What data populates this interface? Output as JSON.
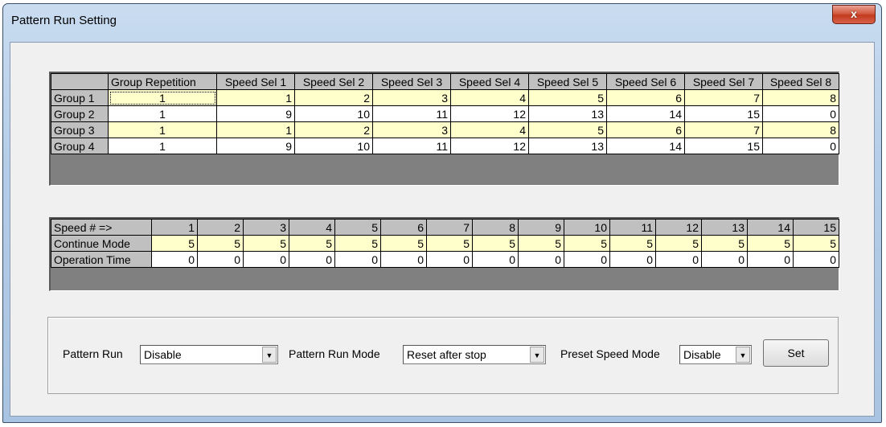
{
  "window": {
    "title": "Pattern Run Setting",
    "close_glyph": "x"
  },
  "group_table": {
    "headers": [
      "",
      "Group Repetition",
      "Speed Sel 1",
      "Speed Sel 2",
      "Speed Sel 3",
      "Speed Sel 4",
      "Speed Sel 5",
      "Speed Sel 6",
      "Speed Sel 7",
      "Speed Sel 8"
    ],
    "rows": [
      {
        "label": "Group 1",
        "cells": [
          "1",
          "1",
          "2",
          "3",
          "4",
          "5",
          "6",
          "7",
          "8"
        ]
      },
      {
        "label": "Group 2",
        "cells": [
          "1",
          "9",
          "10",
          "11",
          "12",
          "13",
          "14",
          "15",
          "0"
        ]
      },
      {
        "label": "Group 3",
        "cells": [
          "1",
          "1",
          "2",
          "3",
          "4",
          "5",
          "6",
          "7",
          "8"
        ]
      },
      {
        "label": "Group 4",
        "cells": [
          "1",
          "9",
          "10",
          "11",
          "12",
          "13",
          "14",
          "15",
          "0"
        ]
      }
    ]
  },
  "speed_table": {
    "header_label": "Speed # =>",
    "headers": [
      "1",
      "2",
      "3",
      "4",
      "5",
      "6",
      "7",
      "8",
      "9",
      "10",
      "11",
      "12",
      "13",
      "14",
      "15"
    ],
    "rows": [
      {
        "label": "Continue Mode",
        "cells": [
          "5",
          "5",
          "5",
          "5",
          "5",
          "5",
          "5",
          "5",
          "5",
          "5",
          "5",
          "5",
          "5",
          "5",
          "5"
        ]
      },
      {
        "label": "Operation Time",
        "cells": [
          "0",
          "0",
          "0",
          "0",
          "0",
          "0",
          "0",
          "0",
          "0",
          "0",
          "0",
          "0",
          "0",
          "0",
          "0"
        ]
      }
    ]
  },
  "settings": {
    "pattern_run_label": "Pattern Run",
    "pattern_run_value": "Disable",
    "pattern_run_mode_label": "Pattern Run Mode",
    "pattern_run_mode_value": "Reset after stop",
    "preset_speed_mode_label": "Preset Speed Mode",
    "preset_speed_mode_value": "Disable",
    "set_label": "Set"
  },
  "colors": {
    "highlight_row": "#ffffcc",
    "header": "#c0c0c0"
  }
}
